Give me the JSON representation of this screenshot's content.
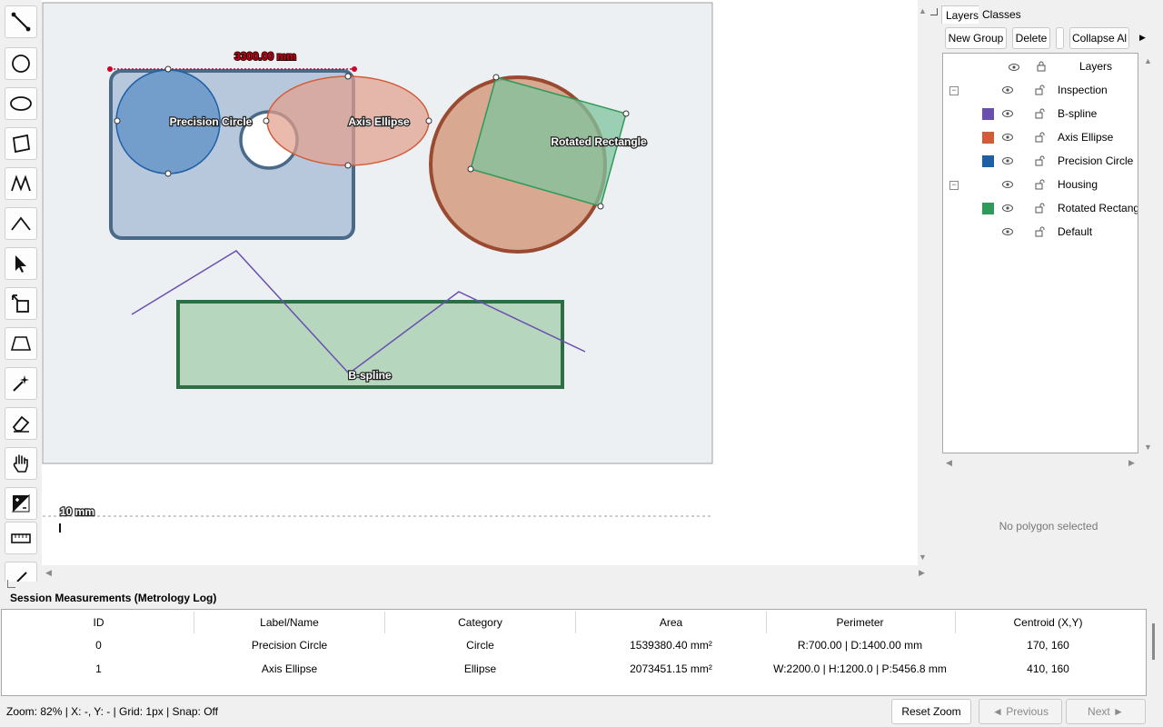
{
  "toolbar": {
    "tools": [
      {
        "icon": "line-tool-icon"
      },
      {
        "icon": "circle-tool-icon"
      },
      {
        "icon": "ellipse-tool-icon"
      },
      {
        "icon": "rotated-rectangle-tool-icon"
      },
      {
        "icon": "polyline-tool-icon"
      },
      {
        "icon": "angle-tool-icon"
      },
      {
        "icon": "select-arrow-icon"
      },
      {
        "icon": "transform-tool-icon"
      },
      {
        "icon": "perspective-tool-icon"
      },
      {
        "icon": "magic-wand-icon"
      },
      {
        "icon": "eraser-icon"
      },
      {
        "icon": "pan-hand-icon"
      },
      {
        "icon": "contrast-icon"
      },
      {
        "icon": "ruler-icon"
      },
      {
        "icon": "pen-icon"
      }
    ]
  },
  "canvas": {
    "dimension_label": "3300.00 mm",
    "scale_bar_label": "10 mm",
    "shape_labels": {
      "precision_circle": "Precision Circle",
      "axis_ellipse": "Axis Ellipse",
      "rotated_rectangle": "Rotated Rectangle",
      "bspline": "B-spline"
    },
    "colors": {
      "housing_fill": "#b7c8dc",
      "housing_stroke": "#4a6a8a",
      "circle_fill": "#6f9cca",
      "circle_stroke": "#1f5fa6",
      "ellipse_fill": "#e2a08e",
      "ellipse_stroke": "#d15c38",
      "rotated_rect_fill": "#7fc49d",
      "rotated_rect_stroke": "#2f9a59",
      "big_circle_fill": "#d8a890",
      "big_circle_stroke": "#9a4a30",
      "bspline_stroke": "#6a4fb0",
      "green_rect_fill": "#b6d6be",
      "green_rect_stroke": "#2e6e45",
      "dimension_color": "#d0002a"
    }
  },
  "right_panel": {
    "tabs": [
      {
        "label": "Layers",
        "active": true
      },
      {
        "label": "Classes",
        "active": false
      }
    ],
    "buttons": {
      "new_group": "New Group",
      "delete": "Delete",
      "collapse_all": "Collapse Al"
    },
    "tree_header": {
      "name": "Layers",
      "eye_icon": "eye-icon",
      "lock_icon": "lock-icon"
    },
    "tree_rows": [
      {
        "name": "Inspection",
        "type": "group",
        "expanded": true,
        "color": ""
      },
      {
        "name": "B-spline",
        "type": "item",
        "color": "#6a4fb0"
      },
      {
        "name": "Axis Ellipse",
        "type": "item",
        "color": "#d15c38"
      },
      {
        "name": "Precision Circle",
        "type": "item",
        "color": "#1f5fa6"
      },
      {
        "name": "Housing",
        "type": "group",
        "expanded": true,
        "color": ""
      },
      {
        "name": "Rotated Rectang",
        "type": "item",
        "color": "#2f9a59"
      },
      {
        "name": "Default",
        "type": "group",
        "expanded": false,
        "color": ""
      }
    ],
    "no_selection_text": "No polygon selected"
  },
  "measurements": {
    "title": "Session Measurements (Metrology Log)",
    "columns": [
      "ID",
      "Label/Name",
      "Category",
      "Area",
      "Perimeter",
      "Centroid (X,Y)"
    ],
    "rows": [
      {
        "id": "0",
        "name": "Precision Circle",
        "category": "Circle",
        "area": "1539380.40 mm²",
        "perimeter": "R:700.00 | D:1400.00 mm",
        "centroid": "170, 160"
      },
      {
        "id": "1",
        "name": "Axis Ellipse",
        "category": "Ellipse",
        "area": "2073451.15 mm²",
        "perimeter": "W:2200.0 | H:1200.0 | P:5456.8 mm",
        "centroid": "410, 160"
      }
    ]
  },
  "status": {
    "text": "Zoom: 82% | X: -, Y: - | Grid: 1px | Snap: Off",
    "reset_zoom": "Reset Zoom",
    "previous": "◄ Previous",
    "next": "Next ►"
  }
}
